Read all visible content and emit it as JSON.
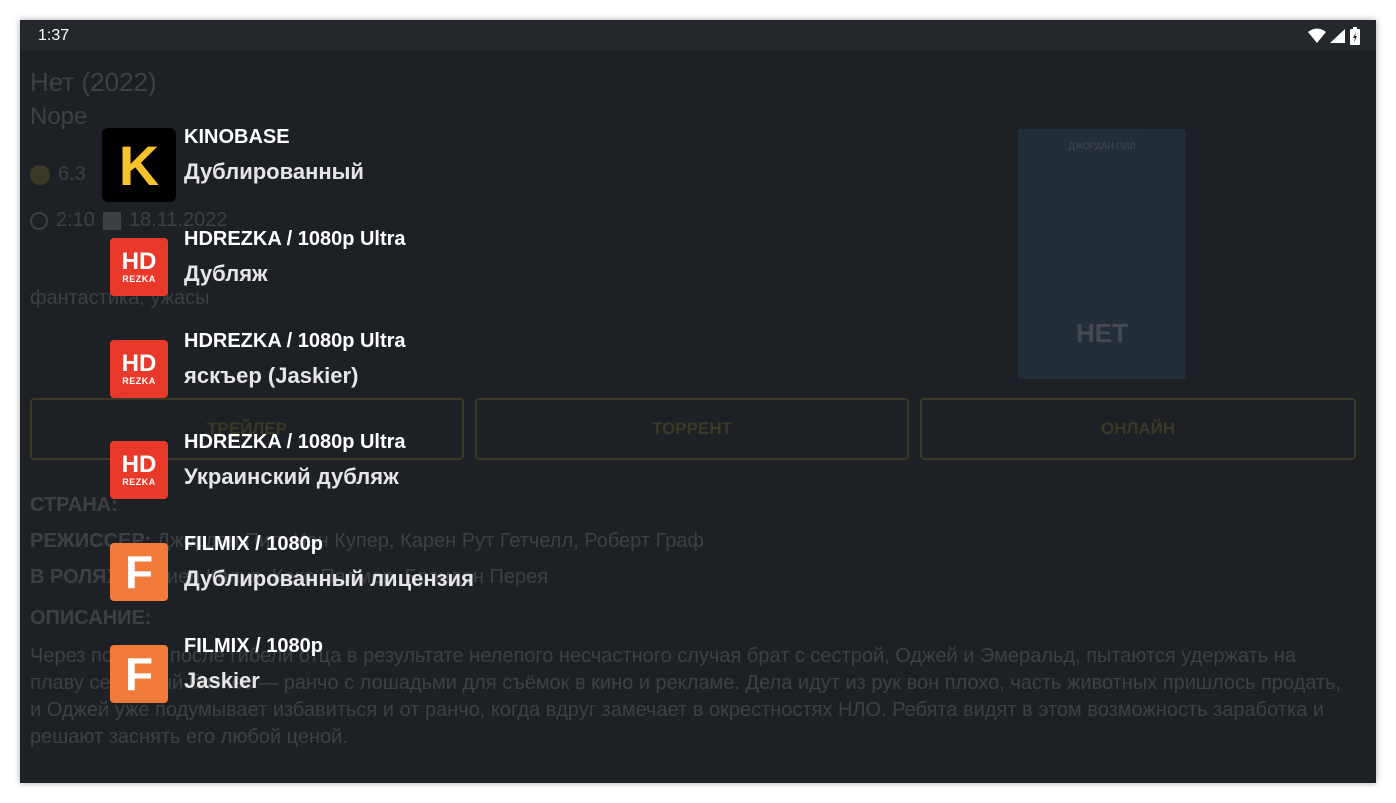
{
  "status_bar": {
    "time": "1:37"
  },
  "background_page": {
    "title": "Нет (2022)",
    "original_title": "Nope",
    "rating": "6.3",
    "duration": "2:10",
    "date": "18.11.2022",
    "genres": "фантастика, ужасы",
    "poster_top_text": "ДЖОРДАН ПИЛ",
    "poster_title": "НЕТ",
    "buttons": {
      "trailer": "ТРЕЙЛЕР",
      "torrent": "ТОРРЕНТ",
      "online": "ОНЛАЙН"
    },
    "country_label": "СТРАНА:",
    "director_label": "РЕЖИССЕР:",
    "director_value": "Джордан Пил, Иэн Купер, Карен Рут Гетчелл, Роберт Граф",
    "cast_label": "В РОЛЯХ:",
    "cast_value": "Дэниел Калуя, Кеке Палмер, Брэндон Перея",
    "description_label": "ОПИСАНИЕ:",
    "description": "Через полгода после гибели отца в результате нелепого несчастного случая брат с сестрой, Оджей и Эмеральд, пытаются удержать на плаву семейный бизнес — ранчо с лошадьми для съёмок в кино и рекламе. Дела идут из рук вон плохо, часть животных пришлось продать, и Оджей уже подумывает избавиться и от ранчо, когда вдруг замечает в окрестностях НЛО. Ребята видят в этом возможность заработка и решают заснять его любой ценой."
  },
  "sources": [
    {
      "name": "KINOBASE",
      "sub": "Дублированный",
      "logo": "K",
      "logo_icon": "kinobase-logo-icon"
    },
    {
      "name": "HDREZKA / 1080p Ultra",
      "sub": "Дубляж",
      "logo_icon": "hdrezka-logo-icon"
    },
    {
      "name": "HDREZKA / 1080p Ultra",
      "sub": "яскъер (Jaskier)",
      "logo_icon": "hdrezka-logo-icon"
    },
    {
      "name": "HDREZKA / 1080p Ultra",
      "sub": "Украинский дубляж",
      "logo_icon": "hdrezka-logo-icon"
    },
    {
      "name": "FILMIX / 1080p",
      "sub": "Дублированный лицензия",
      "logo": "F",
      "logo_icon": "filmix-logo-icon"
    },
    {
      "name": "FILMIX / 1080p",
      "sub": "Jaskier",
      "logo": "F",
      "logo_icon": "filmix-logo-icon"
    }
  ],
  "hdrezka_logo": {
    "top": "HD",
    "bottom": "REZKA"
  },
  "colors": {
    "background": "#1d2126",
    "accent": "#c9a02a",
    "hdrezka": "#e8392b",
    "filmix": "#f07b3a",
    "kinobase": "#f6c22d"
  }
}
